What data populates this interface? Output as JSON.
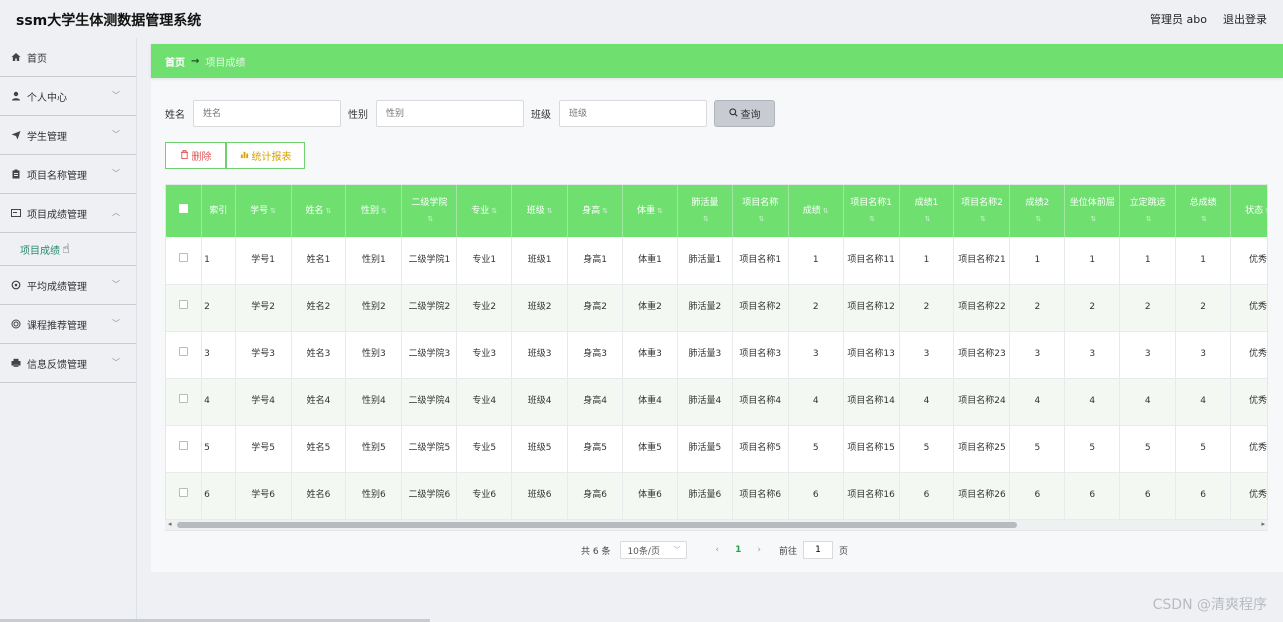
{
  "header": {
    "title": "ssm大学生体测数据管理系统",
    "user": "管理员 abo",
    "logout": "退出登录"
  },
  "sidebar": {
    "items": [
      {
        "label": "首页",
        "icon": "home-icon"
      },
      {
        "label": "个人中心",
        "icon": "user-icon"
      },
      {
        "label": "学生管理",
        "icon": "send-icon"
      },
      {
        "label": "项目名称管理",
        "icon": "clipboard-icon"
      },
      {
        "label": "项目成绩管理",
        "icon": "mail-icon"
      },
      {
        "label": "平均成绩管理",
        "icon": "settings-icon"
      },
      {
        "label": "课程推荐管理",
        "icon": "target-icon"
      },
      {
        "label": "信息反馈管理",
        "icon": "printer-icon"
      }
    ],
    "sub_item": "项目成绩"
  },
  "breadcrumb": {
    "home": "首页",
    "arrow": "→",
    "current": "项目成绩"
  },
  "search": {
    "name_label": "姓名",
    "name_placeholder": "姓名",
    "gender_label": "性别",
    "gender_placeholder": "性别",
    "class_label": "班级",
    "class_placeholder": "班级",
    "search_button": "查询"
  },
  "actions": {
    "delete": "删除",
    "stats": "统计报表"
  },
  "table": {
    "columns": [
      "索引",
      "学号",
      "姓名",
      "性别",
      "二级学院",
      "专业",
      "班级",
      "身高",
      "体重",
      "肺活量",
      "项目名称",
      "成绩",
      "项目名称1",
      "成绩1",
      "项目名称2",
      "成绩2",
      "坐位体前屈",
      "立定跳远",
      "总成绩",
      "状态"
    ],
    "rows": [
      [
        "1",
        "学号1",
        "姓名1",
        "性别1",
        "二级学院1",
        "专业1",
        "班级1",
        "身高1",
        "体重1",
        "肺活量1",
        "项目名称1",
        "1",
        "项目名称11",
        "1",
        "项目名称21",
        "1",
        "1",
        "1",
        "1",
        "优秀"
      ],
      [
        "2",
        "学号2",
        "姓名2",
        "性别2",
        "二级学院2",
        "专业2",
        "班级2",
        "身高2",
        "体重2",
        "肺活量2",
        "项目名称2",
        "2",
        "项目名称12",
        "2",
        "项目名称22",
        "2",
        "2",
        "2",
        "2",
        "优秀"
      ],
      [
        "3",
        "学号3",
        "姓名3",
        "性别3",
        "二级学院3",
        "专业3",
        "班级3",
        "身高3",
        "体重3",
        "肺活量3",
        "项目名称3",
        "3",
        "项目名称13",
        "3",
        "项目名称23",
        "3",
        "3",
        "3",
        "3",
        "优秀"
      ],
      [
        "4",
        "学号4",
        "姓名4",
        "性别4",
        "二级学院4",
        "专业4",
        "班级4",
        "身高4",
        "体重4",
        "肺活量4",
        "项目名称4",
        "4",
        "项目名称14",
        "4",
        "项目名称24",
        "4",
        "4",
        "4",
        "4",
        "优秀"
      ],
      [
        "5",
        "学号5",
        "姓名5",
        "性别5",
        "二级学院5",
        "专业5",
        "班级5",
        "身高5",
        "体重5",
        "肺活量5",
        "项目名称5",
        "5",
        "项目名称15",
        "5",
        "项目名称25",
        "5",
        "5",
        "5",
        "5",
        "优秀"
      ],
      [
        "6",
        "学号6",
        "姓名6",
        "性别6",
        "二级学院6",
        "专业6",
        "班级6",
        "身高6",
        "体重6",
        "肺活量6",
        "项目名称6",
        "6",
        "项目名称16",
        "6",
        "项目名称26",
        "6",
        "6",
        "6",
        "6",
        "优秀"
      ]
    ]
  },
  "pager": {
    "total": "共 6 条",
    "page_size": "10条/页",
    "prev": "‹",
    "current_page": "1",
    "next": "›",
    "goto_label": "前往",
    "goto_value": "1",
    "page_suffix": "页"
  },
  "watermark": "CSDN @清爽程序"
}
